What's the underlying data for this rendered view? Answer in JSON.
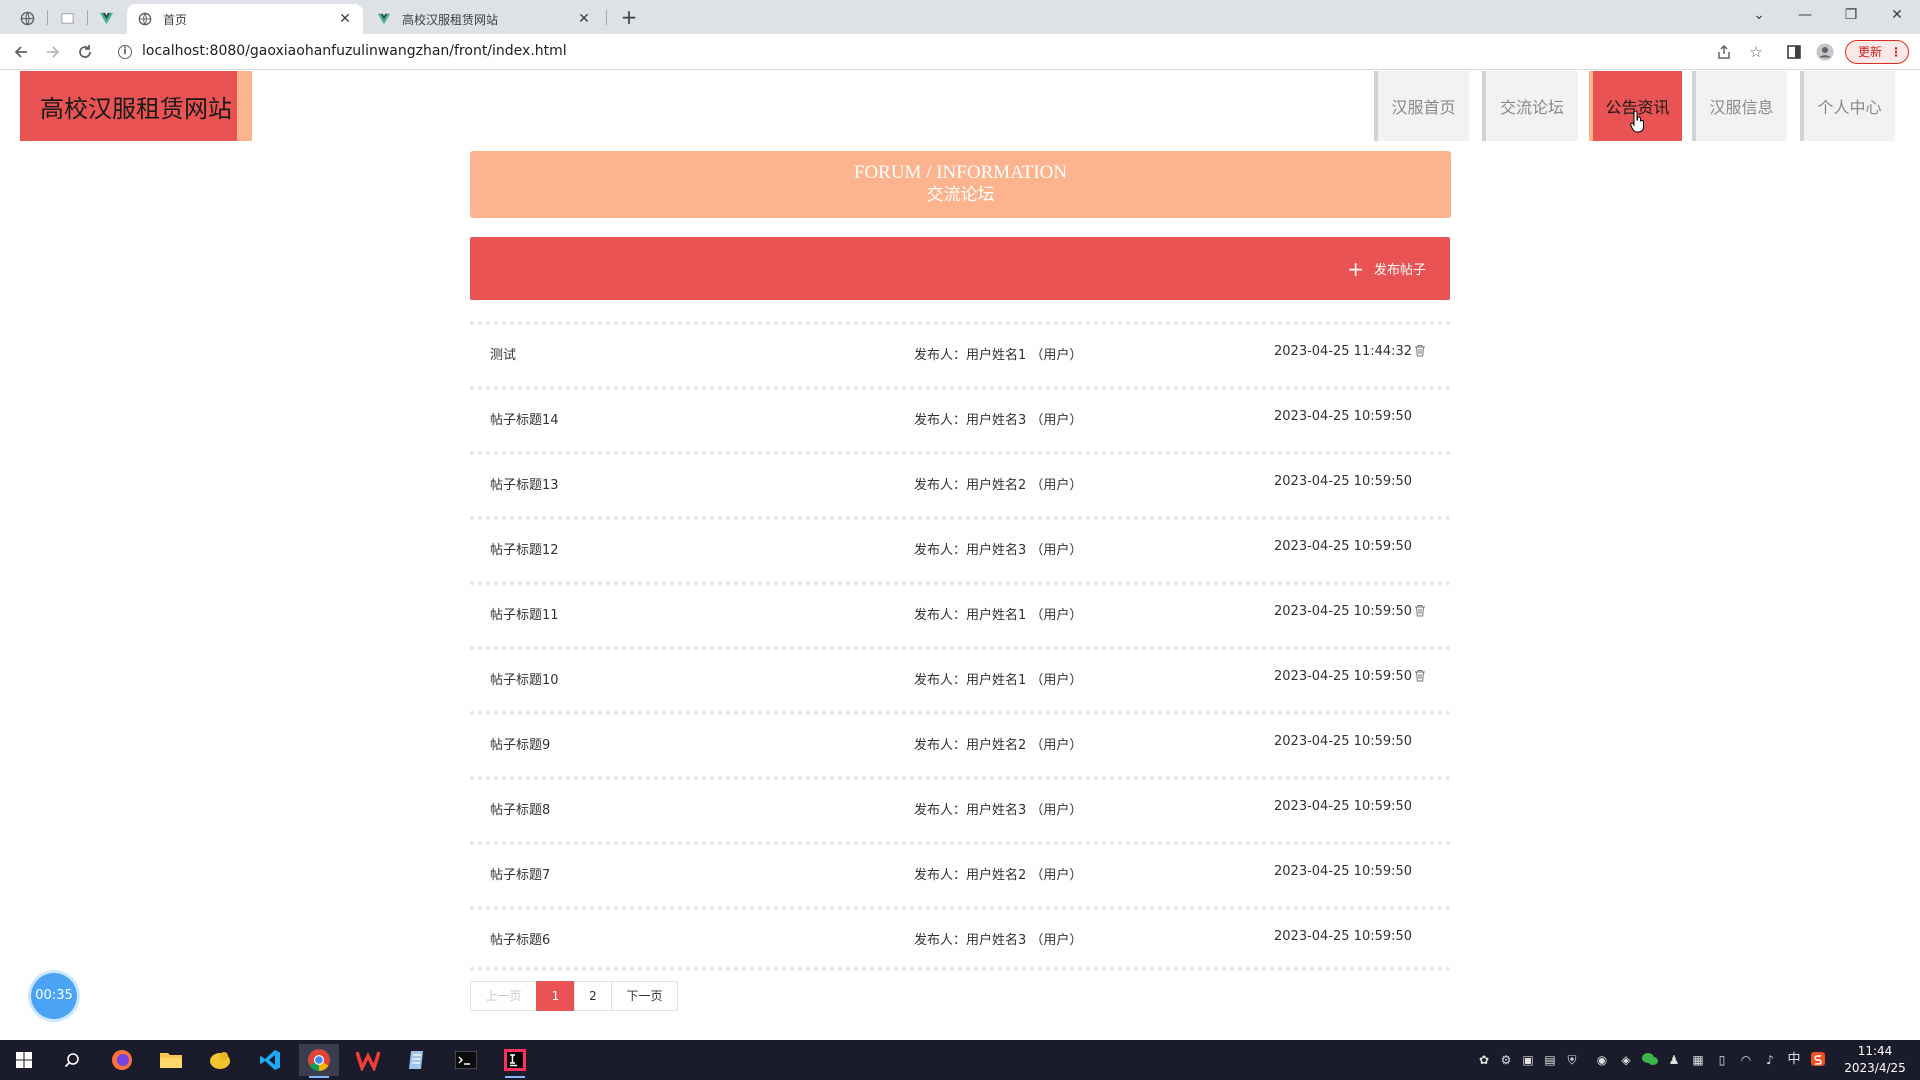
{
  "browser": {
    "tabs": [
      {
        "title": "首页",
        "active": true
      },
      {
        "title": "高校汉服租赁网站",
        "active": false
      }
    ],
    "url": "localhost:8080/gaoxiaohanfuzulinwangzhan/front/index.html",
    "update_label": "更新"
  },
  "site": {
    "name": "高校汉服租赁网站",
    "nav": [
      {
        "label": "汉服首页",
        "active": false
      },
      {
        "label": "交流论坛",
        "active": false
      },
      {
        "label": "公告资讯",
        "active": true
      },
      {
        "label": "汉服信息",
        "active": false
      },
      {
        "label": "个人中心",
        "active": false
      }
    ]
  },
  "banner": {
    "en": "FORUM / INFORMATION",
    "cn": "交流论坛"
  },
  "post_button": {
    "label": "发布帖子"
  },
  "posts": [
    {
      "title": "测试",
      "author": "发布人：用户姓名1 （用户）",
      "time": "2023-04-25 11:44:32",
      "deletable": true
    },
    {
      "title": "帖子标题14",
      "author": "发布人：用户姓名3 （用户）",
      "time": "2023-04-25 10:59:50",
      "deletable": false
    },
    {
      "title": "帖子标题13",
      "author": "发布人：用户姓名2 （用户）",
      "time": "2023-04-25 10:59:50",
      "deletable": false
    },
    {
      "title": "帖子标题12",
      "author": "发布人：用户姓名3 （用户）",
      "time": "2023-04-25 10:59:50",
      "deletable": false
    },
    {
      "title": "帖子标题11",
      "author": "发布人：用户姓名1 （用户）",
      "time": "2023-04-25 10:59:50",
      "deletable": true
    },
    {
      "title": "帖子标题10",
      "author": "发布人：用户姓名1 （用户）",
      "time": "2023-04-25 10:59:50",
      "deletable": true
    },
    {
      "title": "帖子标题9",
      "author": "发布人：用户姓名2 （用户）",
      "time": "2023-04-25 10:59:50",
      "deletable": false
    },
    {
      "title": "帖子标题8",
      "author": "发布人：用户姓名3 （用户）",
      "time": "2023-04-25 10:59:50",
      "deletable": false
    },
    {
      "title": "帖子标题7",
      "author": "发布人：用户姓名2 （用户）",
      "time": "2023-04-25 10:59:50",
      "deletable": false
    },
    {
      "title": "帖子标题6",
      "author": "发布人：用户姓名3 （用户）",
      "time": "2023-04-25 10:59:50",
      "deletable": false
    }
  ],
  "pagination": {
    "prev": "上一页",
    "pages": [
      "1",
      "2"
    ],
    "current": "1",
    "next": "下一页"
  },
  "timer": "00:35",
  "taskbar": {
    "time": "11:44",
    "date": "2023/4/25",
    "ime": "中"
  },
  "colors": {
    "accent": "#e95353",
    "accent_light": "#fdb48e"
  }
}
